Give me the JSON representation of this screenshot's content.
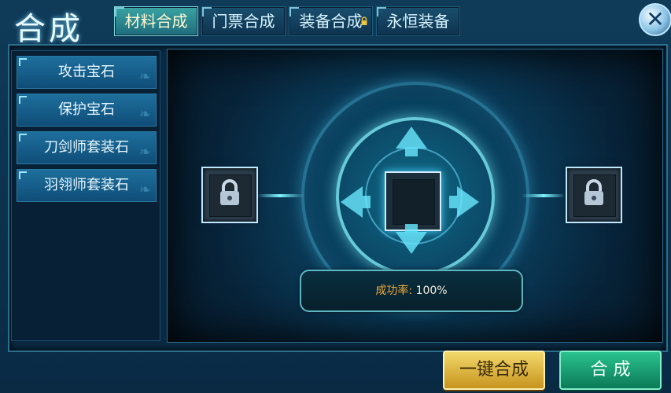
{
  "window": {
    "title": "合成"
  },
  "tabs": [
    {
      "label": "材料合成",
      "active": true,
      "locked": false
    },
    {
      "label": "门票合成",
      "active": false,
      "locked": false
    },
    {
      "label": "装备合成",
      "active": false,
      "locked": true
    },
    {
      "label": "永恒装备",
      "active": false,
      "locked": false
    }
  ],
  "sidebar": {
    "items": [
      {
        "label": "攻击宝石"
      },
      {
        "label": "保护宝石"
      },
      {
        "label": "刀剑师套装石"
      },
      {
        "label": "羽翎师套装石"
      }
    ]
  },
  "stage": {
    "success_label": "成功率:",
    "success_value": "100%"
  },
  "actions": {
    "one_key": "一键合成",
    "combine": "合 成"
  },
  "icons": {
    "close": "close-icon",
    "lock": "lock-icon",
    "tab_lock": "lock-icon"
  },
  "colors": {
    "accent_gold": "#f2a93a",
    "button_gold": "#f2d86a",
    "button_green": "#2ac28e",
    "ring_cyan": "#58d8ff"
  }
}
